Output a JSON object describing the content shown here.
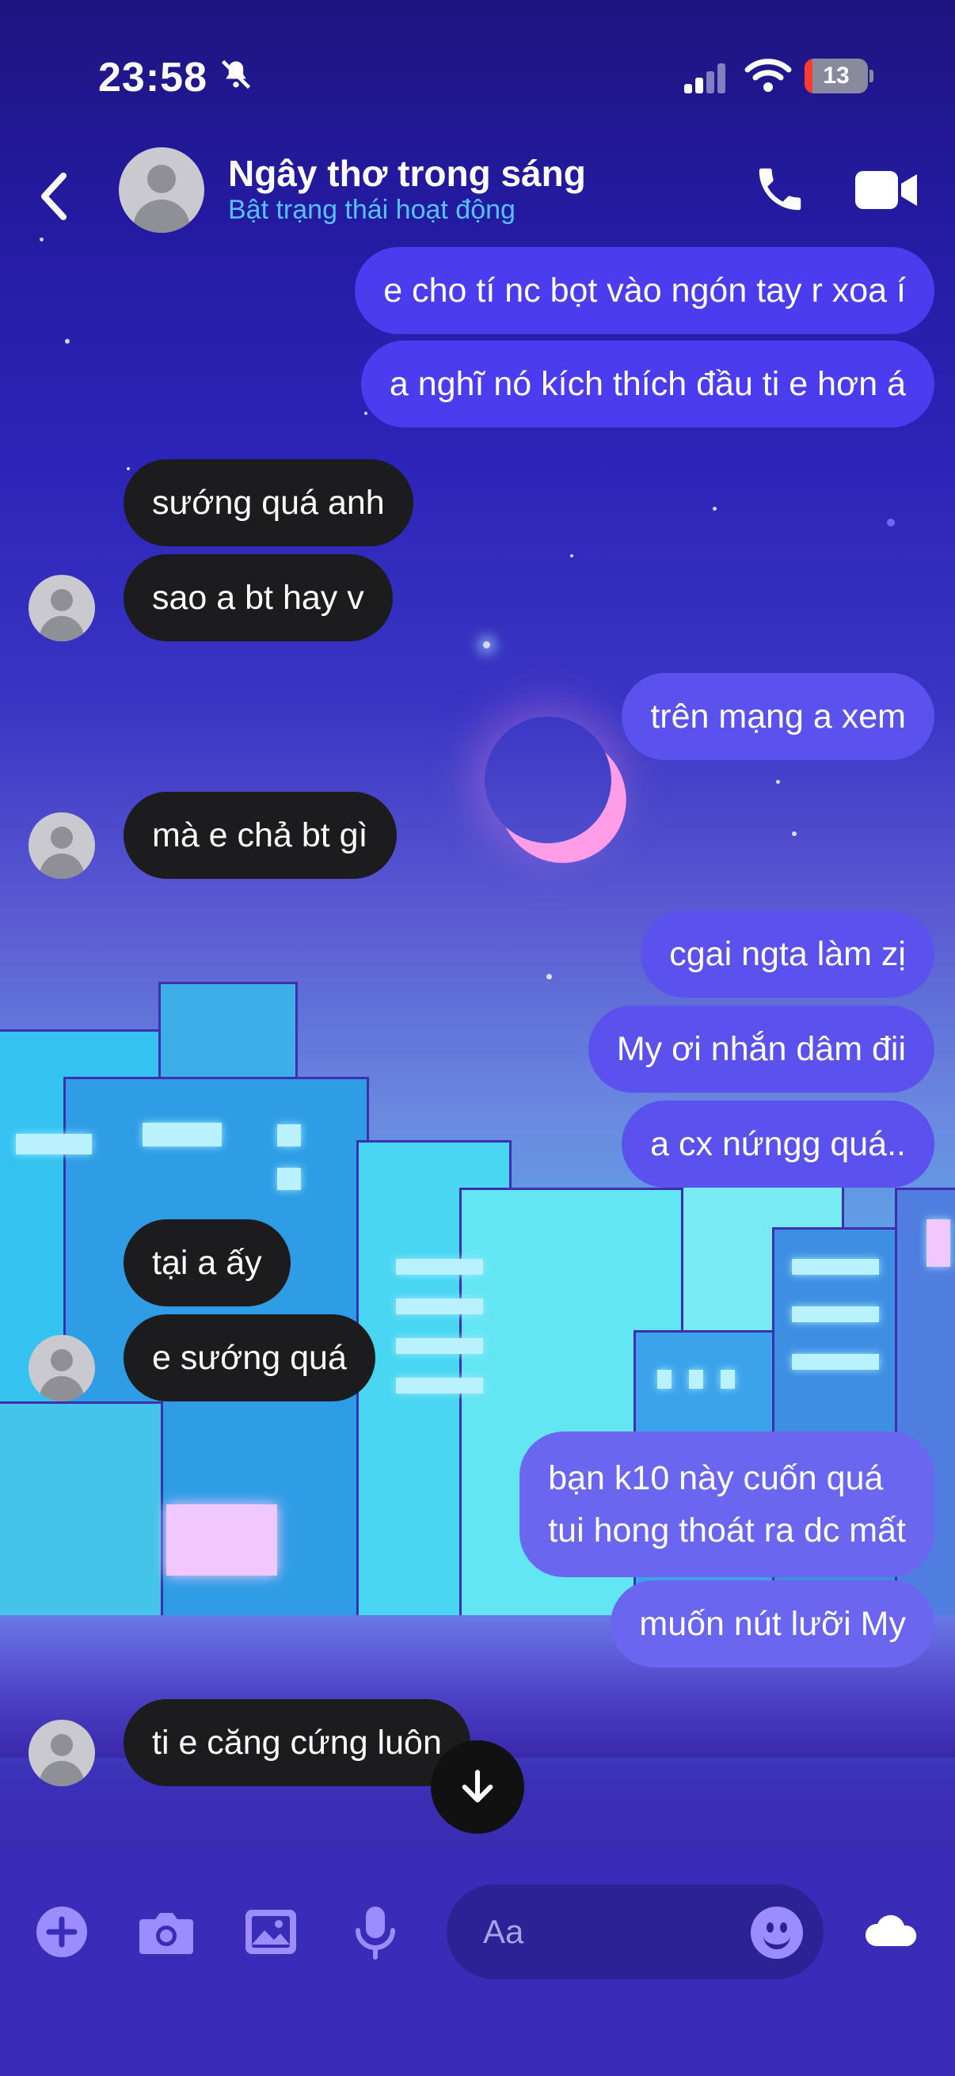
{
  "status_bar": {
    "time": "23:58",
    "battery": "13",
    "icons": [
      "bell-slash-icon",
      "cellular-signal-icon",
      "wifi-icon",
      "battery-icon"
    ]
  },
  "header": {
    "contact_name": "Ngây thơ trong sáng",
    "contact_status": "Bật trạng thái hoạt động",
    "icons": [
      "back-icon",
      "avatar",
      "phone-icon",
      "video-call-icon"
    ]
  },
  "messages": [
    {
      "side": "out",
      "text": "e cho tí nc bọt vào ngón tay r xoa í"
    },
    {
      "side": "out",
      "text": "a nghĩ nó kích thích đầu ti e hơn á"
    },
    {
      "side": "in",
      "text": "sướng quá anh"
    },
    {
      "side": "in",
      "text": "sao a bt hay v"
    },
    {
      "side": "out",
      "text": "trên mạng a xem"
    },
    {
      "side": "in",
      "text": "mà e chả bt gì"
    },
    {
      "side": "out",
      "text": "cgai ngta làm zị"
    },
    {
      "side": "out",
      "text": "My ơi nhắn dâm đii"
    },
    {
      "side": "out",
      "text": "a cx nứngg quá.."
    },
    {
      "side": "in",
      "text": "tại a ấy"
    },
    {
      "side": "in",
      "text": "e sướng quá"
    },
    {
      "side": "out",
      "lines": [
        "bạn k10 này cuốn quá",
        "tui hong thoát ra dc mất"
      ]
    },
    {
      "side": "out",
      "text": "muốn nút lưỡi My"
    },
    {
      "side": "in",
      "text": "ti e căng cứng luôn"
    }
  ],
  "composer": {
    "placeholder": "Aa",
    "icons": [
      "plus-icon",
      "camera-icon",
      "image-icon",
      "microphone-icon",
      "emoji-icon",
      "cloud-icon"
    ]
  },
  "colors": {
    "outgoing_bubble": "#4b3cf0",
    "incoming_bubble": "#1c1c1e",
    "status_accent": "#56c1ff",
    "composer_bg": "#3b2cb8"
  }
}
